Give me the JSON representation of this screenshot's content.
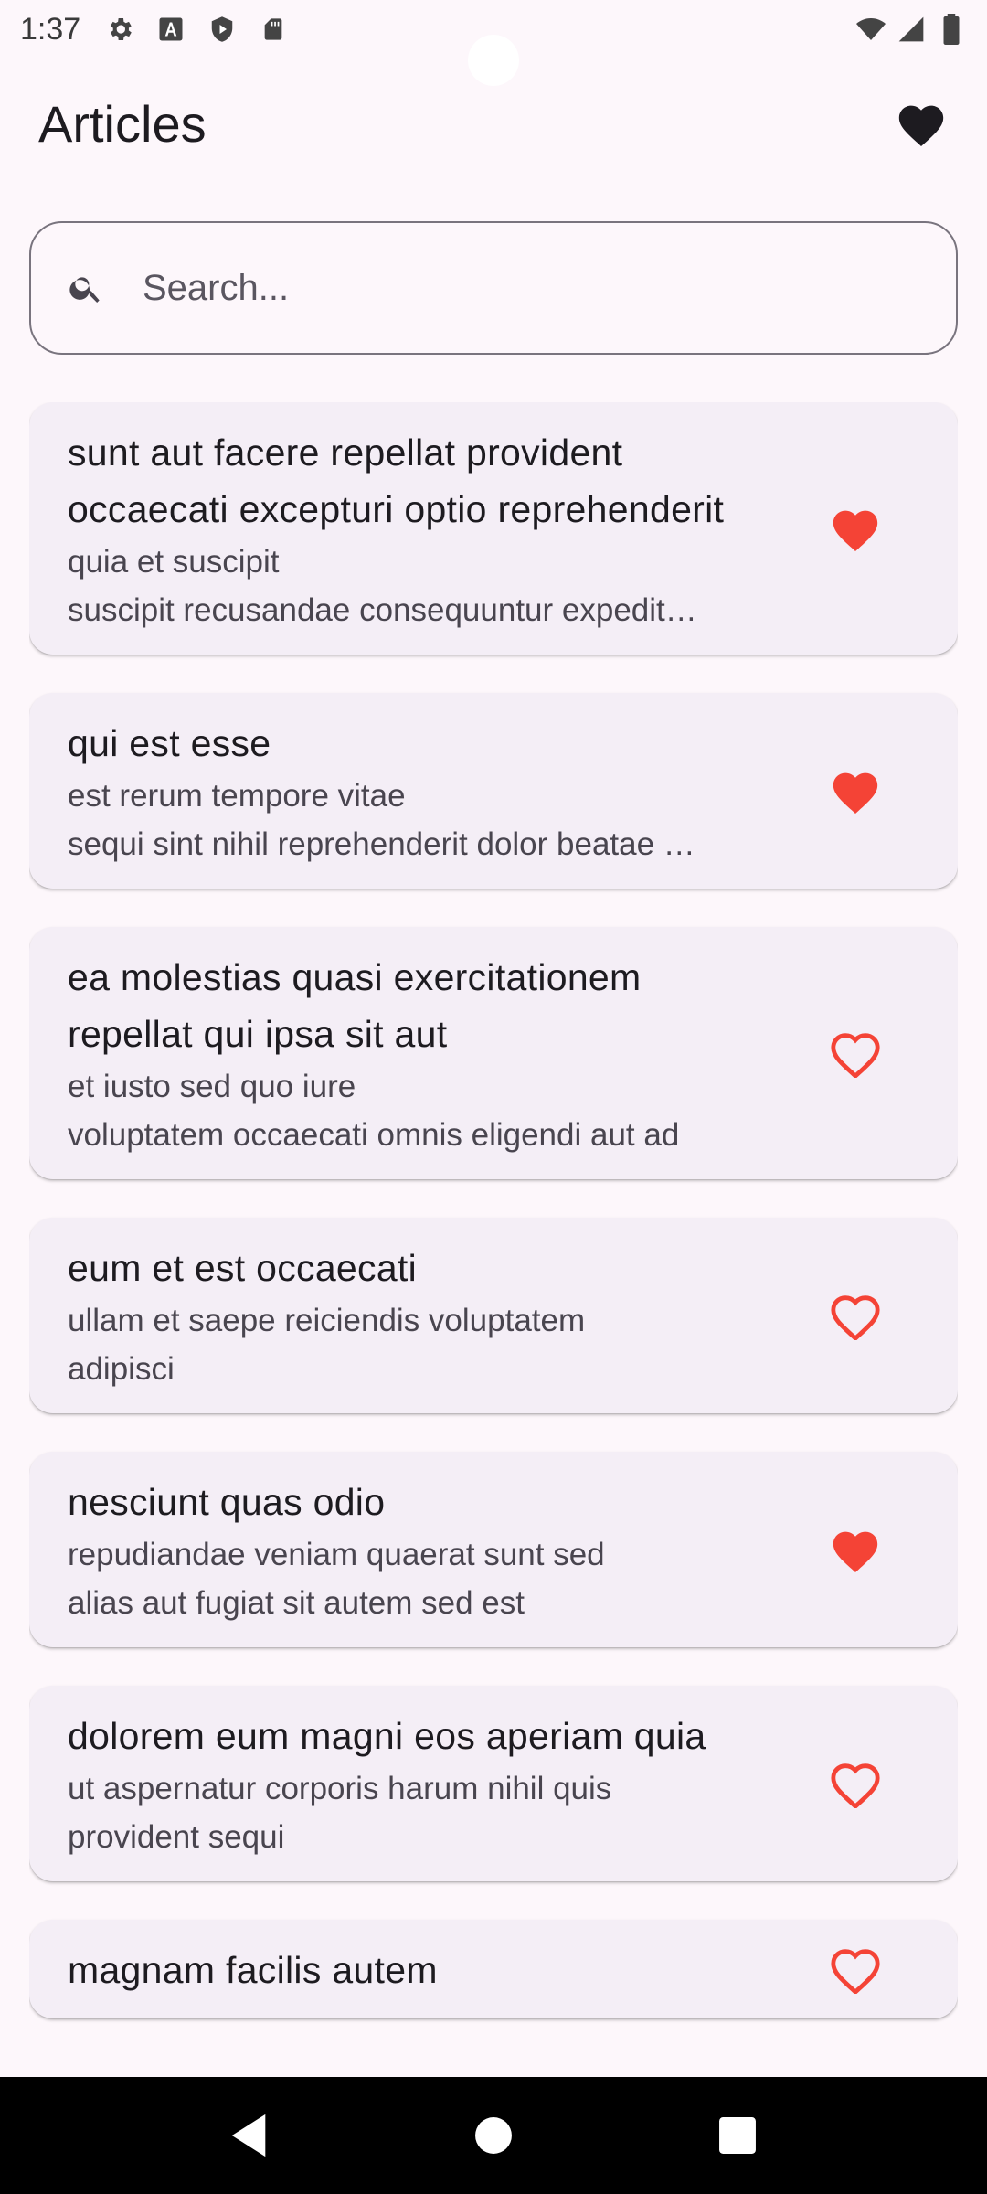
{
  "status_bar": {
    "time": "1:37",
    "left_icons": [
      "settings-icon",
      "font-a-icon",
      "shield-play-icon",
      "sd-card-icon"
    ],
    "right_icons": [
      "wifi-icon",
      "signal-icon",
      "battery-icon"
    ]
  },
  "app_bar": {
    "title": "Articles",
    "favorites_icon": "heart-filled-icon",
    "favorites_color": "#1d1b20"
  },
  "search": {
    "placeholder": "Search...",
    "value": "",
    "icon": "search-icon"
  },
  "colors": {
    "accent_red": "#f44336",
    "card_bg": "#f4eef6",
    "page_bg": "#fdf7fb"
  },
  "articles": [
    {
      "title": "sunt aut facere repellat provident occaecati excepturi optio reprehenderit",
      "body": "quia et suscipit\nsuscipit recusandae consequuntur expedit…",
      "favorite": true
    },
    {
      "title": "qui est esse",
      "body": "est rerum tempore vitae\nsequi sint nihil reprehenderit dolor beatae …",
      "favorite": true
    },
    {
      "title": "ea molestias quasi exercitationem repellat qui ipsa sit aut",
      "body": "et iusto sed quo iure\nvoluptatem occaecati omnis eligendi aut ad",
      "favorite": false
    },
    {
      "title": "eum et est occaecati",
      "body": "ullam et saepe reiciendis voluptatem\nadipisci",
      "favorite": false
    },
    {
      "title": "nesciunt quas odio",
      "body": "repudiandae veniam quaerat sunt sed\nalias aut fugiat sit autem sed est",
      "favorite": true
    },
    {
      "title": "dolorem eum magni eos aperiam quia",
      "body": "ut aspernatur corporis harum nihil quis\nprovident sequi",
      "favorite": false
    },
    {
      "title": "magnam facilis autem",
      "body": "",
      "favorite": false
    }
  ],
  "nav_bar": {
    "buttons": [
      "back-icon",
      "home-icon",
      "recents-icon"
    ]
  }
}
